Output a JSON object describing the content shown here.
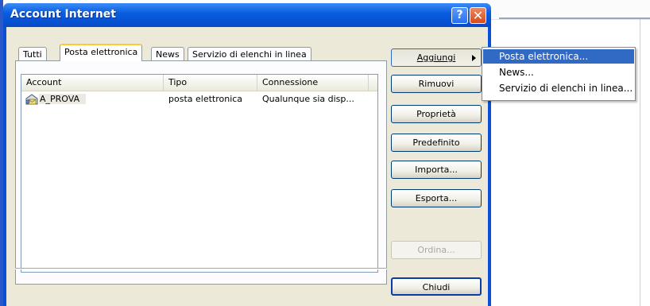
{
  "dialog": {
    "title": "Account Internet",
    "help_glyph": "?",
    "close_glyph": "✕"
  },
  "tabs": [
    {
      "label": "Tutti",
      "active": false
    },
    {
      "label": "Posta elettronica",
      "active": true
    },
    {
      "label": "News",
      "active": false
    },
    {
      "label": "Servizio di elenchi in linea",
      "active": false
    }
  ],
  "list": {
    "columns": [
      "Account",
      "Tipo",
      "Connessione"
    ],
    "rows": [
      {
        "account": "A_PROVA",
        "tipo": "posta elettronica",
        "connessione": "Qualunque sia disp...",
        "icon": "mail-account-icon"
      }
    ]
  },
  "buttons": {
    "aggiungi": "Aggiungi",
    "rimuovi": "Rimuovi",
    "proprieta": "Proprietà",
    "predefinito": "Predefinito",
    "importa": "Importa...",
    "esporta": "Esporta...",
    "ordina": "Ordina...",
    "chiudi": "Chiudi"
  },
  "menu": {
    "items": [
      {
        "label": "Posta elettronica...",
        "highlighted": true
      },
      {
        "label": "News...",
        "highlighted": false
      },
      {
        "label": "Servizio di elenchi in linea...",
        "highlighted": false
      }
    ]
  },
  "colors": {
    "titlebar": "#0a5ee0",
    "dialog_face": "#ece9d8",
    "menu_highlight": "#316ac5",
    "active_tab_accent": "#ffc83c"
  }
}
